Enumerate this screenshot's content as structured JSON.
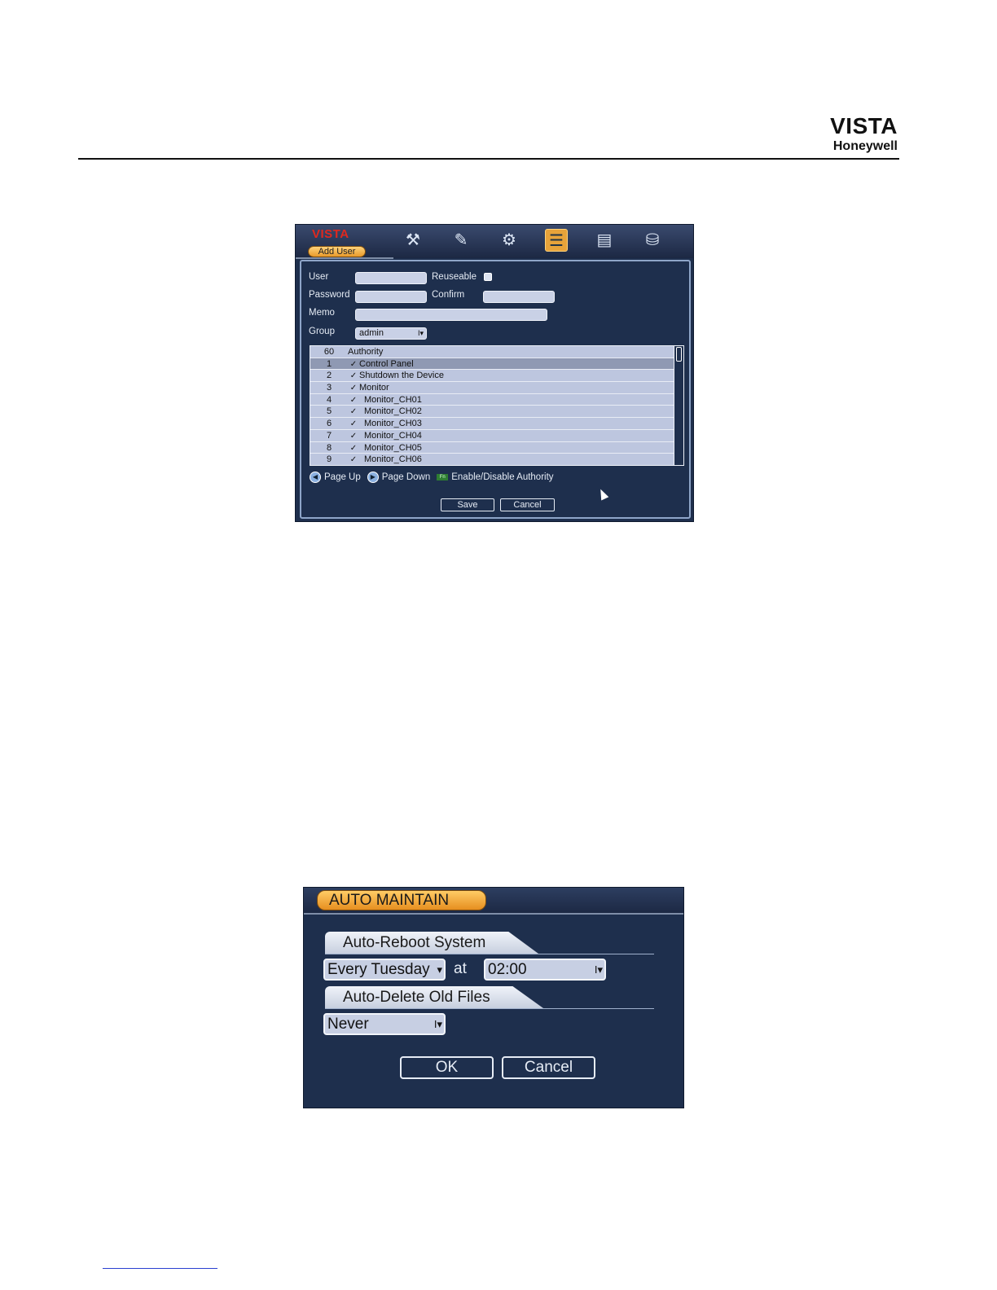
{
  "page": {
    "brand_title": "VISTA",
    "brand_subtitle": "Honeywell"
  },
  "add_user": {
    "logo": "VISTA",
    "tab_label": "Add User",
    "top_icons": [
      "tools-icon",
      "note-icon",
      "wrench-icon",
      "clipboard-icon",
      "monitor-icon",
      "disk-icon"
    ],
    "active_icon_index": 3,
    "user_label": "User",
    "user_value": "",
    "reuseable_label": "Reuseable",
    "reuseable_checked": false,
    "password_label": "Password",
    "password_value": "",
    "confirm_label": "Confirm",
    "confirm_value": "",
    "memo_label": "Memo",
    "memo_value": "",
    "group_label": "Group",
    "group_value": "admin",
    "authority_table": {
      "header_count": "60",
      "header_title": "Authority",
      "rows": [
        {
          "num": "1",
          "label": "Control Panel",
          "checked": true,
          "indent": false,
          "highlighted": true
        },
        {
          "num": "2",
          "label": "Shutdown the Device",
          "checked": true,
          "indent": false,
          "highlighted": false
        },
        {
          "num": "3",
          "label": "Monitor",
          "checked": true,
          "indent": false,
          "highlighted": false
        },
        {
          "num": "4",
          "label": "Monitor_CH01",
          "checked": true,
          "indent": true,
          "highlighted": false
        },
        {
          "num": "5",
          "label": "Monitor_CH02",
          "checked": true,
          "indent": true,
          "highlighted": false
        },
        {
          "num": "6",
          "label": "Monitor_CH03",
          "checked": true,
          "indent": true,
          "highlighted": false
        },
        {
          "num": "7",
          "label": "Monitor_CH04",
          "checked": true,
          "indent": true,
          "highlighted": false
        },
        {
          "num": "8",
          "label": "Monitor_CH05",
          "checked": true,
          "indent": true,
          "highlighted": false
        },
        {
          "num": "9",
          "label": "Monitor_CH06",
          "checked": true,
          "indent": true,
          "highlighted": false
        }
      ]
    },
    "page_up_label": "Page Up",
    "page_down_label": "Page Down",
    "fn_key_label": "Fn",
    "enable_disable_label": "Enable/Disable Authority",
    "save_label": "Save",
    "cancel_label": "Cancel"
  },
  "auto_maintain": {
    "tab_label": "AUTO MAINTAIN",
    "reboot_section": "Auto-Reboot System",
    "reboot_day": "Every Tuesday",
    "at_label": "at",
    "reboot_time": "02:00",
    "delete_section": "Auto-Delete Old Files",
    "delete_value": "Never",
    "ok_label": "OK",
    "cancel_label": "Cancel"
  },
  "colors": {
    "panel_bg": "#1e2f4d",
    "accent_orange": "#e89a2a",
    "logo_red": "#e0281e"
  }
}
